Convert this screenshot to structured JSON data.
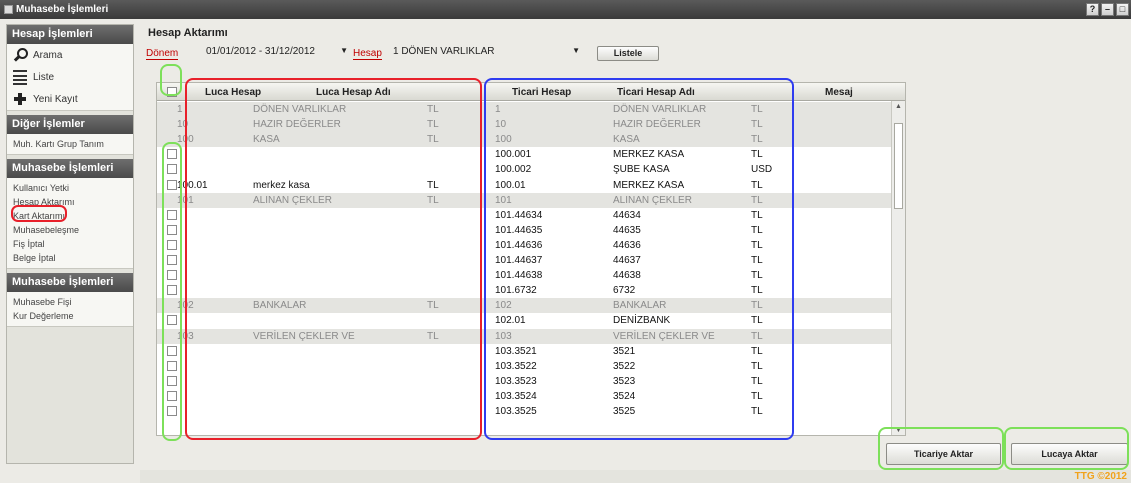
{
  "window": {
    "title": "Muhasebe İşlemleri",
    "controls": [
      "?",
      "–",
      "□"
    ]
  },
  "sidebar": {
    "sections": [
      {
        "title": "Hesap İşlemleri",
        "items": [
          {
            "label": "Arama",
            "icon": "search-icon"
          },
          {
            "label": "Liste",
            "icon": "list-icon"
          },
          {
            "label": "Yeni Kayıt",
            "icon": "add-record-icon"
          }
        ]
      },
      {
        "title": "Diğer İşlemler",
        "items": [
          {
            "label": "Muh. Kartı Grup Tanım"
          }
        ]
      },
      {
        "title": "Muhasebe İşlemleri",
        "items": [
          {
            "label": "Kullanıcı Yetki"
          },
          {
            "label": "Hesap Aktarımı"
          },
          {
            "label": "Kart Aktarımı"
          },
          {
            "label": "Muhasebeleşme"
          },
          {
            "label": "Fiş İptal"
          },
          {
            "label": "Belge İptal"
          }
        ]
      },
      {
        "title": "Muhasebe İşlemleri",
        "items": [
          {
            "label": "Muhasebe Fişi"
          },
          {
            "label": "Kur Değerleme"
          }
        ]
      }
    ]
  },
  "main": {
    "title": "Hesap Aktarımı",
    "filters": {
      "donem_label": "Dönem",
      "donem_value": "01/01/2012 - 31/12/2012",
      "hesap_label": "Hesap",
      "hesap_value": "1 DÖNEN VARLIKLAR",
      "list_button": "Listele"
    },
    "grid": {
      "headers": [
        "Luca Hesap",
        "Luca Hesap Adı",
        "Ticari Hesap",
        "Ticari Hesap Adı",
        "Mesaj"
      ],
      "rows": [
        {
          "style": "grey",
          "check": false,
          "luca": "1",
          "luca_name": "DÖNEN VARLIKLAR",
          "luca_cur": "TL",
          "ticari": "1",
          "ticari_name": "DÖNEN VARLIKLAR",
          "ticari_cur": "TL"
        },
        {
          "style": "grey",
          "check": false,
          "luca": "10",
          "luca_name": "HAZIR DEĞERLER",
          "luca_cur": "TL",
          "ticari": "10",
          "ticari_name": "HAZIR DEĞERLER",
          "ticari_cur": "TL"
        },
        {
          "style": "grey",
          "check": false,
          "luca": "100",
          "luca_name": "KASA",
          "luca_cur": "TL",
          "ticari": "100",
          "ticari_name": "KASA",
          "ticari_cur": "TL"
        },
        {
          "style": "white",
          "check": true,
          "luca": "",
          "luca_name": "",
          "luca_cur": "",
          "ticari": "100.001",
          "ticari_name": "MERKEZ KASA",
          "ticari_cur": "TL"
        },
        {
          "style": "white",
          "check": true,
          "luca": "",
          "luca_name": "",
          "luca_cur": "",
          "ticari": "100.002",
          "ticari_name": "ŞUBE KASA",
          "ticari_cur": "USD"
        },
        {
          "style": "white",
          "check": true,
          "luca": "100.01",
          "luca_name": "merkez kasa",
          "luca_cur": "TL",
          "ticari": "100.01",
          "ticari_name": "MERKEZ KASA",
          "ticari_cur": "TL"
        },
        {
          "style": "grey",
          "check": false,
          "luca": "101",
          "luca_name": "ALINAN ÇEKLER",
          "luca_cur": "TL",
          "ticari": "101",
          "ticari_name": "ALINAN ÇEKLER",
          "ticari_cur": "TL"
        },
        {
          "style": "white",
          "check": true,
          "luca": "",
          "luca_name": "",
          "luca_cur": "",
          "ticari": "101.44634",
          "ticari_name": "44634",
          "ticari_cur": "TL"
        },
        {
          "style": "white",
          "check": true,
          "luca": "",
          "luca_name": "",
          "luca_cur": "",
          "ticari": "101.44635",
          "ticari_name": "44635",
          "ticari_cur": "TL"
        },
        {
          "style": "white",
          "check": true,
          "luca": "",
          "luca_name": "",
          "luca_cur": "",
          "ticari": "101.44636",
          "ticari_name": "44636",
          "ticari_cur": "TL"
        },
        {
          "style": "white",
          "check": true,
          "luca": "",
          "luca_name": "",
          "luca_cur": "",
          "ticari": "101.44637",
          "ticari_name": "44637",
          "ticari_cur": "TL"
        },
        {
          "style": "white",
          "check": true,
          "luca": "",
          "luca_name": "",
          "luca_cur": "",
          "ticari": "101.44638",
          "ticari_name": "44638",
          "ticari_cur": "TL"
        },
        {
          "style": "white",
          "check": true,
          "luca": "",
          "luca_name": "",
          "luca_cur": "",
          "ticari": "101.6732",
          "ticari_name": "6732",
          "ticari_cur": "TL"
        },
        {
          "style": "grey",
          "check": false,
          "luca": "102",
          "luca_name": "BANKALAR",
          "luca_cur": "TL",
          "ticari": "102",
          "ticari_name": "BANKALAR",
          "ticari_cur": "TL"
        },
        {
          "style": "white",
          "check": true,
          "luca": "",
          "luca_name": "",
          "luca_cur": "",
          "ticari": "102.01",
          "ticari_name": "DENİZBANK",
          "ticari_cur": "TL"
        },
        {
          "style": "grey",
          "check": false,
          "luca": "103",
          "luca_name": "VERİLEN ÇEKLER VE",
          "luca_cur": "TL",
          "ticari": "103",
          "ticari_name": "VERİLEN ÇEKLER VE",
          "ticari_cur": "TL"
        },
        {
          "style": "white",
          "check": true,
          "luca": "",
          "luca_name": "",
          "luca_cur": "",
          "ticari": "103.3521",
          "ticari_name": "3521",
          "ticari_cur": "TL"
        },
        {
          "style": "white",
          "check": true,
          "luca": "",
          "luca_name": "",
          "luca_cur": "",
          "ticari": "103.3522",
          "ticari_name": "3522",
          "ticari_cur": "TL"
        },
        {
          "style": "white",
          "check": true,
          "luca": "",
          "luca_name": "",
          "luca_cur": "",
          "ticari": "103.3523",
          "ticari_name": "3523",
          "ticari_cur": "TL"
        },
        {
          "style": "white",
          "check": true,
          "luca": "",
          "luca_name": "",
          "luca_cur": "",
          "ticari": "103.3524",
          "ticari_name": "3524",
          "ticari_cur": "TL"
        },
        {
          "style": "white",
          "check": true,
          "luca": "",
          "luca_name": "",
          "luca_cur": "",
          "ticari": "103.3525",
          "ticari_name": "3525",
          "ticari_cur": "TL"
        }
      ]
    },
    "buttons": {
      "ticari": "Ticariye Aktar",
      "luca": "Lucaya Aktar"
    }
  },
  "watermark": "TTG ©2012",
  "colors": {
    "highlight_red": "#e8202a",
    "highlight_blue": "#2f3cf0",
    "highlight_green": "#7de05a",
    "label_red": "#c00000",
    "watermark": "#f1a21a"
  }
}
